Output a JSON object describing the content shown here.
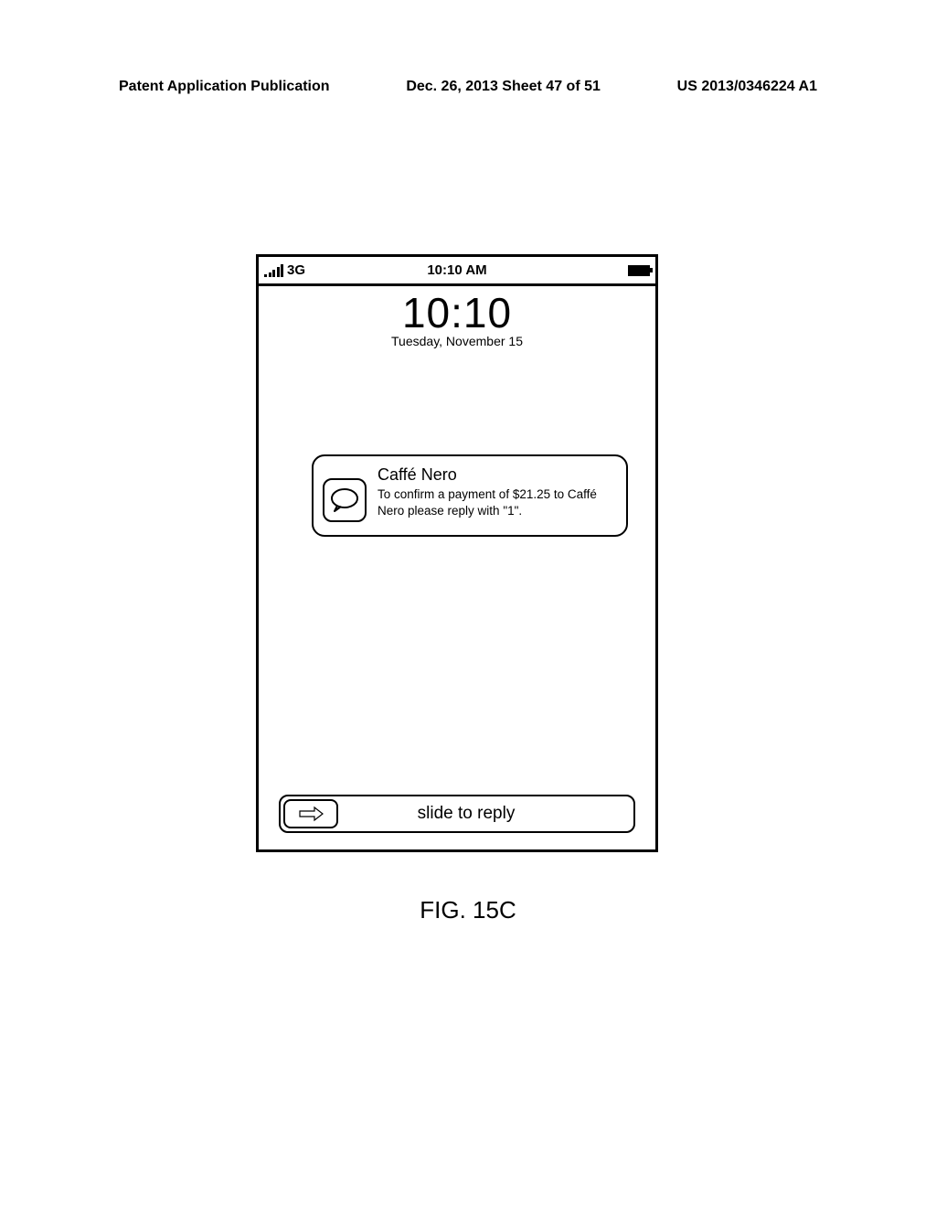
{
  "page_header": {
    "left": "Patent Application Publication",
    "center": "Dec. 26, 2013  Sheet 47 of 51",
    "right": "US 2013/0346224 A1"
  },
  "status_bar": {
    "network": "3G",
    "time": "10:10 AM"
  },
  "clock": {
    "time": "10:10",
    "date": "Tuesday, November 15"
  },
  "notification": {
    "title": "Caffé Nero",
    "body": "To confirm a payment of $21.25 to Caffé Nero please reply with  \"1\"."
  },
  "slider": {
    "label": "slide to reply"
  },
  "figure_caption": "FIG. 15C"
}
